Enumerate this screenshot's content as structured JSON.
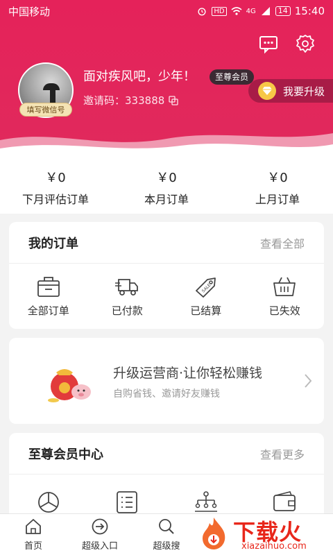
{
  "statusbar": {
    "carrier": "中国移动",
    "network": "HD",
    "signal": "4G",
    "battery": "14",
    "time": "15:40"
  },
  "profile": {
    "nickname": "面对疾风吧，少年！",
    "vip_label": "至尊会员",
    "invite_label": "邀请码：",
    "invite_code": "333888",
    "wechat_tag": "填写微信号",
    "upgrade_label": "我要升级"
  },
  "stats": [
    {
      "value": "￥0",
      "label": "下月评估订单"
    },
    {
      "value": "￥0",
      "label": "本月订单"
    },
    {
      "value": "￥0",
      "label": "上月订单"
    }
  ],
  "orders": {
    "title": "我的订单",
    "more": "查看全部",
    "items": [
      {
        "label": "全部订单",
        "icon": "shopping-bag-icon"
      },
      {
        "label": "已付款",
        "icon": "delivery-truck-icon"
      },
      {
        "label": "已结算",
        "icon": "sale-tag-icon"
      },
      {
        "label": "已失效",
        "icon": "basket-icon"
      }
    ]
  },
  "promo": {
    "title": "升级运营商·让你轻松赚钱",
    "subtitle": "自购省钱、邀请好友赚钱"
  },
  "vip_center": {
    "title": "至尊会员中心",
    "more": "查看更多",
    "items": [
      "pie-chart-icon",
      "list-icon",
      "hierarchy-icon",
      "wallet-icon"
    ]
  },
  "tabbar": [
    {
      "label": "首页",
      "icon": "home-icon"
    },
    {
      "label": "超级入口",
      "icon": "enter-icon"
    },
    {
      "label": "超级搜",
      "icon": "search-icon"
    }
  ],
  "watermark": {
    "text": "下载火",
    "url": "xiazaihuo.com"
  },
  "colors": {
    "brand": "#e5225a",
    "watermark": "#e8271b"
  }
}
